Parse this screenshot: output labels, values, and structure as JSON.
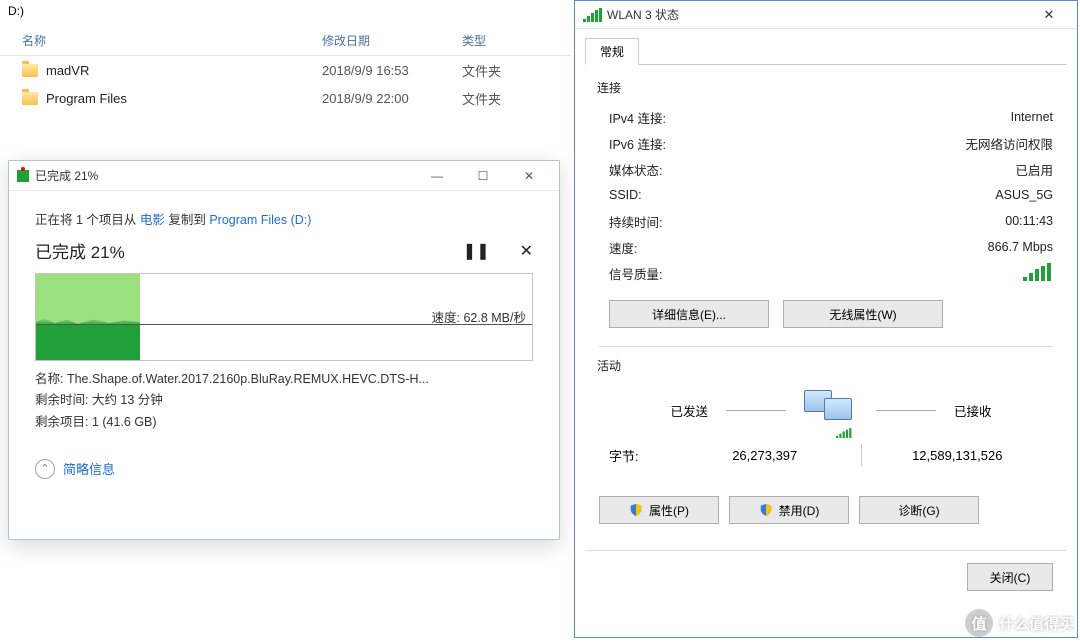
{
  "explorer": {
    "drive": "D:)",
    "cols": {
      "name": "名称",
      "date": "修改日期",
      "type": "类型"
    },
    "rows": [
      {
        "name": "madVR",
        "date": "2018/9/9 16:53",
        "type": "文件夹"
      },
      {
        "name": "Program Files",
        "date": "2018/9/9 22:00",
        "type": "文件夹"
      }
    ]
  },
  "copy": {
    "title": "已完成 21%",
    "line_prefix": "正在将 1 个项目从 ",
    "src": "电影",
    "mid": " 复制到 ",
    "dst": "Program Files (D:)",
    "pct_label": "已完成 21%",
    "speed": "速度: 62.8 MB/秒",
    "name_label": "名称: ",
    "name_value": "The.Shape.of.Water.2017.2160p.BluRay.REMUX.HEVC.DTS-H...",
    "remain_time": "剩余时间: 大约 13 分钟",
    "remain_items": "剩余项目: 1 (41.6 GB)",
    "collapse": "简略信息",
    "progress_percent": 21
  },
  "wlan": {
    "title": "WLAN 3 状态",
    "tab": "常规",
    "connection_section": "连接",
    "rows": {
      "ipv4_k": "IPv4 连接:",
      "ipv4_v": "Internet",
      "ipv6_k": "IPv6 连接:",
      "ipv6_v": "无网络访问权限",
      "media_k": "媒体状态:",
      "media_v": "已启用",
      "ssid_k": "SSID:",
      "ssid_v": "ASUS_5G",
      "dur_k": "持续时间:",
      "dur_v": "00:11:43",
      "speed_k": "速度:",
      "speed_v": "866.7 Mbps",
      "sig_k": "信号质量:"
    },
    "details_btn": "详细信息(E)...",
    "wireless_btn": "无线属性(W)",
    "activity_section": "活动",
    "sent": "已发送",
    "recv": "已接收",
    "bytes_label": "字节:",
    "bytes_sent": "26,273,397",
    "bytes_recv": "12,589,131,526",
    "prop_btn": "属性(P)",
    "disable_btn": "禁用(D)",
    "diag_btn": "诊断(G)",
    "close_btn": "关闭(C)"
  },
  "watermark": "什么值得买"
}
